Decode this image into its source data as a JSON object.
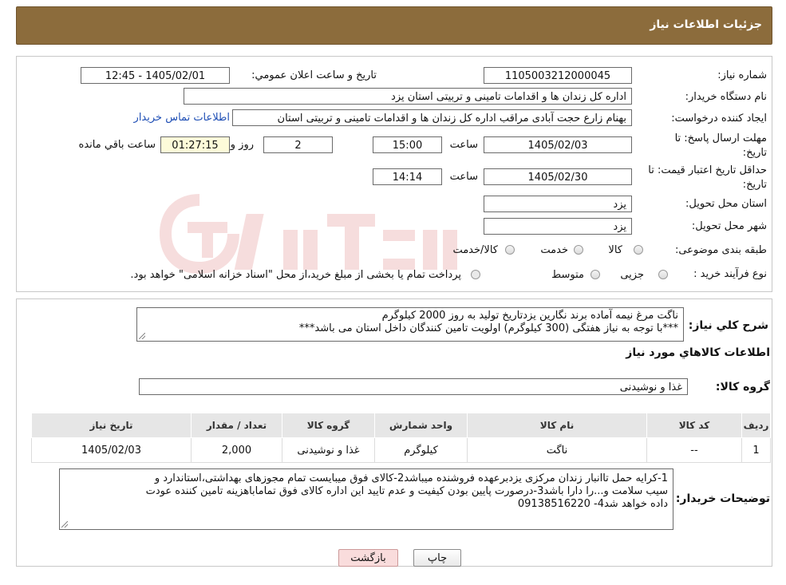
{
  "header": {
    "title": "جزئیات اطلاعات نیاز"
  },
  "form": {
    "need_number_label": "شماره نیاز:",
    "need_number": "1105003212000045",
    "announce_label": "تاریخ و ساعت اعلان عمومي:",
    "announce_value": "1405/02/01 - 12:45",
    "buyer_label": "نام دستگاه خریدار:",
    "buyer_value": "اداره کل زندان ها و اقدامات تامینی و تربیتی استان یزد",
    "creator_label": "ایجاد کننده درخواست:",
    "creator_value": "بهنام زارع حجت آبادی مراقب اداره کل زندان ها و اقدامات تامینی و تربیتی استان",
    "contact_link": "اطلاعات تماس خریدار",
    "deadline_label_1": "مهلت ارسال پاسخ: تا",
    "deadline_label_2": "تاریخ:",
    "deadline_date": "1405/02/03",
    "time_label": "ساعت",
    "deadline_time": "15:00",
    "days_value": "2",
    "days_label": "روز و",
    "remaining_value": "01:27:15",
    "remaining_label": "ساعت باقي مانده",
    "validity_label_1": "حداقل تاریخ اعتبار قیمت: تا",
    "validity_label_2": "تاریخ:",
    "validity_date": "1405/02/30",
    "validity_time": "14:14",
    "province_label": "استان محل تحویل:",
    "province_value": "یزد",
    "city_label": "شهر محل تحویل:",
    "city_value": "یزد",
    "category_label": "طبقه بندی موضوعی:",
    "category_options": [
      "کالا",
      "خدمت",
      "کالا/خدمت"
    ],
    "process_label": "نوع فرآیند خرید :",
    "process_options": [
      "جزیی",
      "متوسط"
    ],
    "process_note": "پرداخت تمام یا بخشی از مبلغ خرید،از محل \"اسناد خزانه اسلامی\" خواهد بود."
  },
  "summary": {
    "label": "شرح کلي نیاز:",
    "line1": "ناگت مرغ نیمه آماده برند نگارین یزدتاریخ تولید به روز 2000 کیلوگرم",
    "line2": "***با توجه به نیاز هفتگی (300 کیلوگرم) اولویت تامین کنندگان داخل استان می باشد***"
  },
  "goods": {
    "section_title": "اطلاعات کالاهاي مورد نیاز",
    "group_label": "گروه کالا:",
    "group_value": "غذا و نوشیدنی",
    "columns": [
      "ردیف",
      "کد کالا",
      "نام کالا",
      "واحد شمارش",
      "گروه کالا",
      "تعداد / مقدار",
      "تاریخ نیاز"
    ],
    "rows": [
      [
        "1",
        "--",
        "ناگت",
        "کیلوگرم",
        "غذا و نوشیدنی",
        "2,000",
        "1405/02/03"
      ]
    ]
  },
  "buyer_notes": {
    "label": "توضیحات خریدار:",
    "line1": "1-کرایه حمل تاانبار زندان مرکزی یزدبرعهده فروشنده میباشد2-کالای فوق میبایست تمام مجوزهای بهداشتی،استاندارد و",
    "line2": "سیب سلامت و...را دارا باشد3-درصورت پایین بودن کیفیت و عدم تایید این اداره کالای فوق تماماباهزینه تامین کننده عودت",
    "line3": "داده خواهد شد4- 09138516220"
  },
  "buttons": {
    "print": "چاپ",
    "back": "بازگشت"
  },
  "colors": {
    "header_bg": "#8c6c3c",
    "back_btn_bg": "#f9dcdc",
    "link": "#1f4fb5"
  }
}
